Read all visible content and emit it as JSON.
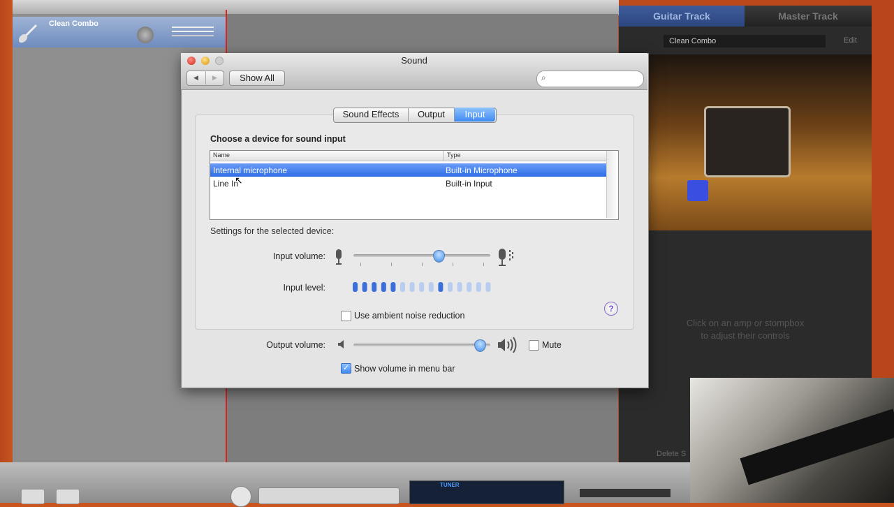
{
  "background_app": {
    "track_name": "Clean Combo",
    "tabs": [
      "Guitar Track",
      "Master Track"
    ],
    "preset": "Clean Combo",
    "edit_label": "Edit",
    "hint": "Click on an amp or stompbox to adjust their controls",
    "delete_label": "Delete S",
    "lcd_label": "TUNER"
  },
  "window": {
    "title": "Sound",
    "show_all_label": "Show All",
    "back_glyph": "◀",
    "forward_glyph": "▶",
    "search_placeholder": "",
    "search_icon": "magnifier-icon"
  },
  "tabs": [
    {
      "label": "Sound Effects",
      "selected": false
    },
    {
      "label": "Output",
      "selected": false
    },
    {
      "label": "Input",
      "selected": true
    }
  ],
  "input_pane": {
    "choose_label": "Choose a device for sound input",
    "columns": [
      "Name",
      "Type"
    ],
    "devices": [
      {
        "name": "Internal microphone",
        "type": "Built-in Microphone",
        "selected": true
      },
      {
        "name": "Line In",
        "type": "Built-in Input",
        "selected": false
      }
    ],
    "settings_label": "Settings for the selected device:",
    "input_volume_label": "Input volume:",
    "input_volume": 0.62,
    "input_level_label": "Input level:",
    "input_level_segments_lit": 5,
    "input_level_peak_segment": 10,
    "input_level_total_segments": 15,
    "ambient_label": "Use ambient noise reduction",
    "ambient_checked": false
  },
  "output_controls": {
    "output_volume_label": "Output volume:",
    "output_volume": 0.92,
    "mute_label": "Mute",
    "mute_checked": false,
    "menubar_label": "Show volume in menu bar",
    "menubar_checked": true
  },
  "colors": {
    "selection": "#3a77ea",
    "slider_thumb": "#3d8ae8",
    "level_on": "#3c6fd8",
    "level_off": "#b9cdf0"
  }
}
